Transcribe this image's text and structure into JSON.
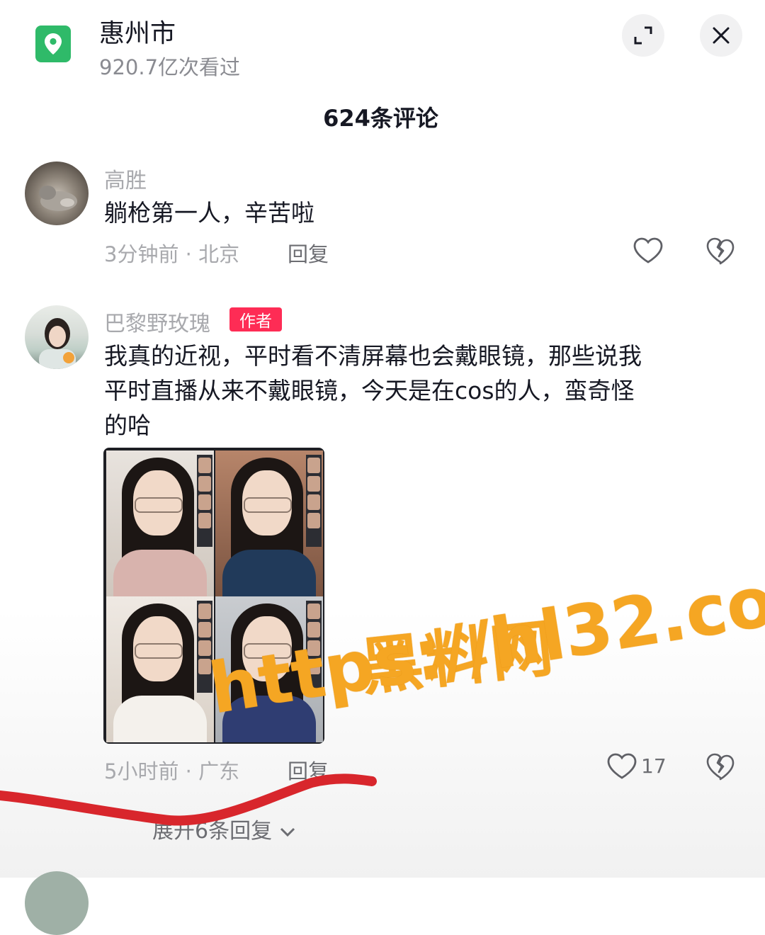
{
  "header": {
    "location_title": "惠州市",
    "views_text": "920.7亿次看过",
    "icons": [
      "map-pin-icon",
      "expand-icon",
      "close-icon"
    ]
  },
  "comments_count_title": "624条评论",
  "comments": [
    {
      "username": "高胜",
      "text": "躺枪第一人，辛苦啦",
      "meta": "3分钟前 · 北京",
      "reply_label": "回复"
    },
    {
      "username": "巴黎野玫瑰",
      "author_tag": "作者",
      "text_lines": [
        "我真的近视，平时看不清屏幕也会戴眼镜，那些说我",
        "平时直播从来不戴眼镜，今天是在cos的人，蛮奇怪",
        "的哈"
      ],
      "meta": "5小时前 · 广东",
      "reply_label": "回复",
      "like_count": "17",
      "expand_replies": "展开6条回复"
    }
  ],
  "watermark": {
    "line1": "黑料网",
    "line2": "https://hl32.co"
  },
  "colors": {
    "accent_red": "#fe2c55",
    "pin_green": "#2fba69",
    "watermark_orange": "#f5a623",
    "scribble_red": "#d8262c"
  }
}
